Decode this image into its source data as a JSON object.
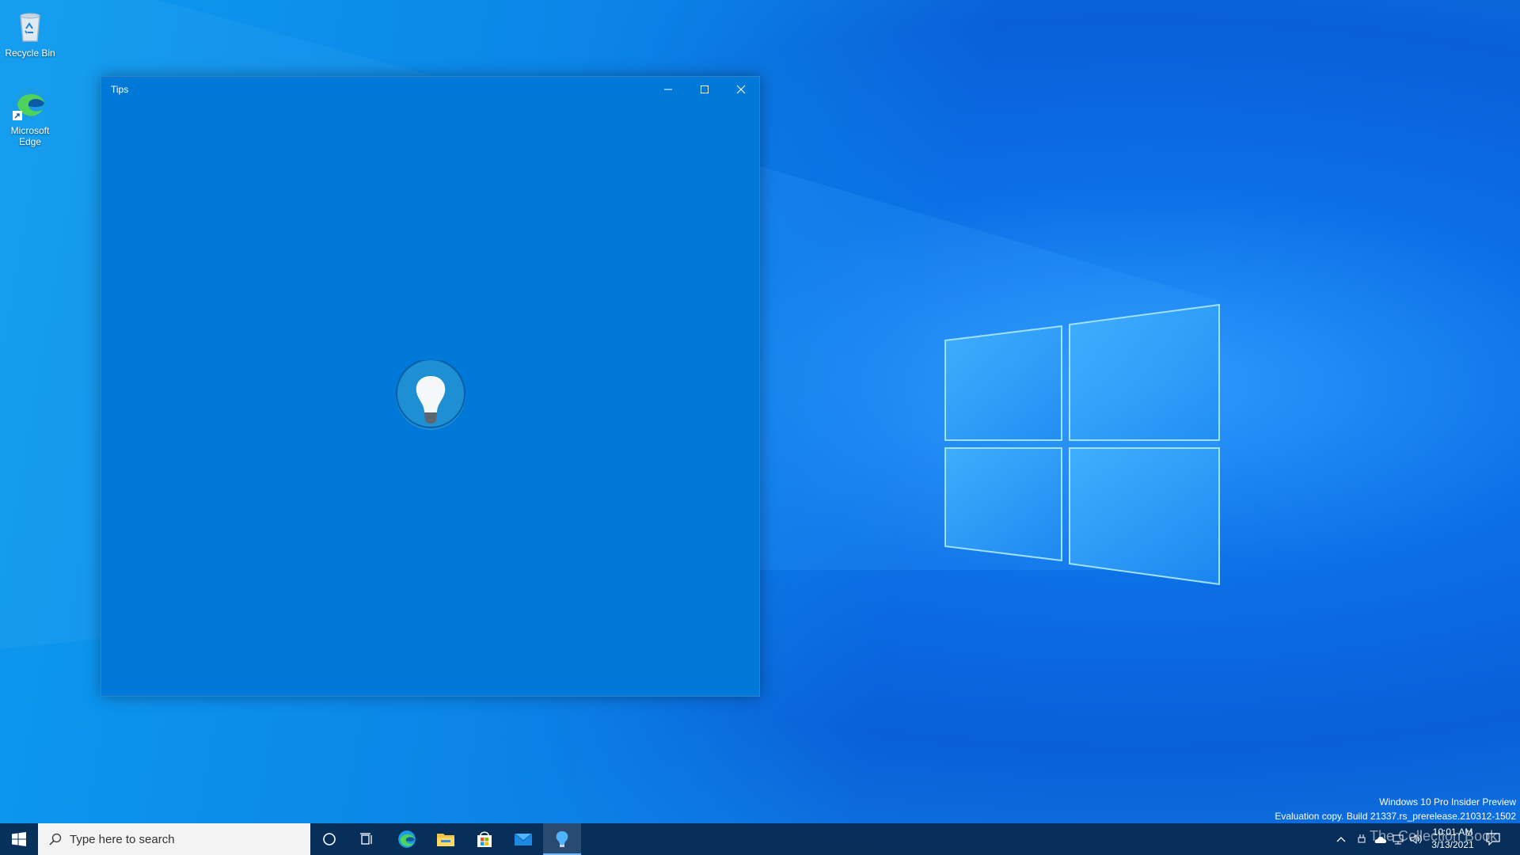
{
  "desktop": {
    "icons": [
      {
        "label": "Recycle Bin"
      },
      {
        "label": "Microsoft Edge"
      }
    ]
  },
  "window": {
    "title": "Tips",
    "app_icon": "lightbulb-icon",
    "background_color": "#0078d7"
  },
  "watermark": {
    "line1": "Windows 10 Pro Insider Preview",
    "line2": "Evaluation copy. Build 21337.rs_prerelease.210312-1502"
  },
  "taskbar": {
    "search_placeholder": "Type here to search",
    "pinned": [
      "cortana-icon",
      "task-view-icon",
      "edge-icon",
      "file-explorer-icon",
      "store-icon",
      "mail-icon",
      "tips-icon"
    ],
    "active_app": "tips-icon",
    "clock_time": "10:01 AM",
    "clock_date": "3/13/2021"
  },
  "overlay_watermark": "The Collection Book"
}
